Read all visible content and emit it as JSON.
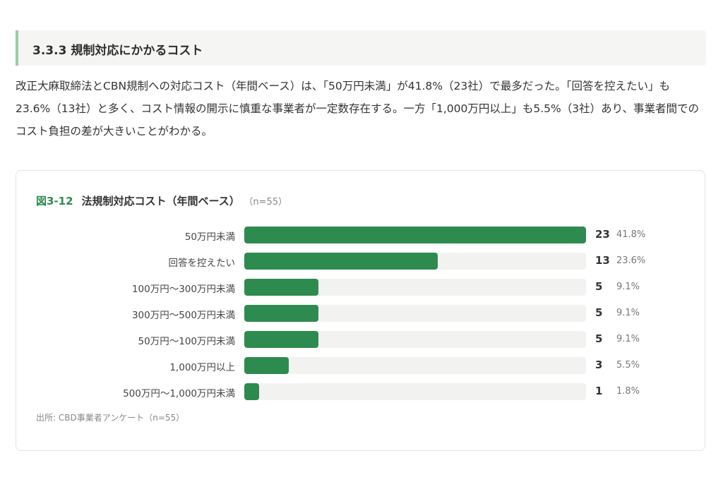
{
  "section": {
    "heading": "3.3.3 規制対応にかかるコスト",
    "paragraph": "改正大麻取締法とCBN規制への対応コスト（年間ベース）は、「50万円未満」が41.8%（23社）で最多だった。「回答を控えたい」も23.6%（13社）と多く、コスト情報の開示に慎重な事業者が一定数存在する。一方「1,000万円以上」も5.5%（3社）あり、事業者間でのコスト負担の差が大きいことがわかる。"
  },
  "figure": {
    "number": "図3-12",
    "title": "法規制対応コスト（年間ベース）",
    "n_label": "（n=55）",
    "source": "出所: CBD事業者アンケート（n=55）"
  },
  "colors": {
    "bar": "#2e8b4f",
    "track": "#f2f2f0",
    "accent": "#2e8b4f"
  },
  "chart_data": {
    "type": "bar",
    "orientation": "horizontal",
    "title": "法規制対応コスト（年間ベース）",
    "xlim": [
      0,
      23
    ],
    "grid": false,
    "legend": "none",
    "categories": [
      "50万円未満",
      "回答を控えたい",
      "100万円〜300万円未満",
      "300万円〜500万円未満",
      "50万円〜100万円未満",
      "1,000万円以上",
      "500万円〜1,000万円未満"
    ],
    "values": [
      23,
      13,
      5,
      5,
      5,
      3,
      1
    ],
    "percent_labels": [
      "41.8%",
      "23.6%",
      "9.1%",
      "9.1%",
      "9.1%",
      "5.5%",
      "1.8%"
    ]
  }
}
